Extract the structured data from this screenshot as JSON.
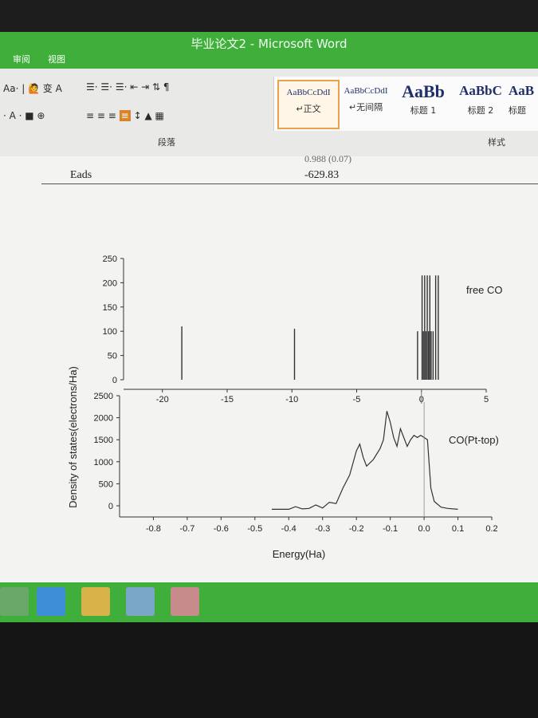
{
  "window": {
    "title": "毕业论文2 - Microsoft Word"
  },
  "menu": {
    "items": [
      "审阅",
      "视图"
    ]
  },
  "ribbon": {
    "font_row1": "Aa· | 🙋 变 A",
    "font_row2": "· A · ■ ⊕",
    "paragraph_label": "段落",
    "styles_label": "样式",
    "styles": [
      {
        "sample": "AaBbCcDdI",
        "name": "↵正文",
        "active": true
      },
      {
        "sample": "AaBbCcDdI",
        "name": "↵无间隔",
        "active": false
      },
      {
        "sample": "AaBb",
        "name": "标题 1",
        "active": false
      },
      {
        "sample": "AaBbC",
        "name": "标题 2",
        "active": false
      },
      {
        "sample": "AaB",
        "name": "标题",
        "active": false
      }
    ]
  },
  "document": {
    "cut_row_value": "0.988 (0.07)",
    "eads_label": "Eads",
    "eads_value": "-629.83"
  },
  "chart_data": [
    {
      "type": "bar",
      "title": "free CO",
      "xlim": [
        -23,
        5
      ],
      "ylim": [
        0,
        250
      ],
      "xticks": [
        -20,
        -15,
        -10,
        -5,
        0,
        5
      ],
      "yticks": [
        0,
        50,
        100,
        150,
        200,
        250
      ],
      "x": [
        -18.5,
        -9.8,
        -0.3,
        0.05,
        0.15,
        0.25,
        0.35,
        0.45,
        0.55,
        0.65,
        0.75,
        0.9,
        1.1,
        1.3
      ],
      "values": [
        110,
        105,
        100,
        215,
        100,
        215,
        100,
        215,
        100,
        215,
        100,
        100,
        215,
        215
      ],
      "grid": false
    },
    {
      "type": "line",
      "title": "CO(Pt-top)",
      "xlim": [
        -0.9,
        0.2
      ],
      "ylim": [
        0,
        2500
      ],
      "xticks": [
        -0.8,
        -0.7,
        -0.6,
        -0.5,
        -0.4,
        -0.3,
        -0.2,
        -0.1,
        0.0,
        0.1,
        0.2
      ],
      "xtick_labels": [
        "-0.8",
        "-0.7",
        "-0.6",
        "-0.5",
        "-0.4",
        "-0.3",
        "-0.2",
        "-0.1",
        "0.0",
        "0.1",
        "0.2"
      ],
      "yticks": [
        0,
        500,
        1000,
        1500,
        2000,
        2500
      ],
      "xlabel": "Energy(Ha)",
      "x": [
        -0.45,
        -0.4,
        -0.38,
        -0.36,
        -0.34,
        -0.32,
        -0.3,
        -0.28,
        -0.26,
        -0.24,
        -0.22,
        -0.2,
        -0.19,
        -0.18,
        -0.17,
        -0.15,
        -0.13,
        -0.12,
        -0.11,
        -0.1,
        -0.09,
        -0.08,
        -0.07,
        -0.06,
        -0.05,
        -0.04,
        -0.03,
        -0.02,
        -0.01,
        0.0,
        0.01,
        0.02,
        0.03,
        0.05,
        0.07,
        0.1
      ],
      "values": [
        -80,
        -80,
        -20,
        -70,
        -60,
        20,
        -50,
        80,
        50,
        400,
        700,
        1250,
        1400,
        1100,
        900,
        1050,
        1300,
        1500,
        2150,
        1900,
        1550,
        1350,
        1750,
        1550,
        1350,
        1500,
        1600,
        1550,
        1600,
        1550,
        1500,
        400,
        100,
        -30,
        -60,
        -80
      ],
      "grid": false
    }
  ],
  "shared_axis": {
    "ylabel": "Density of states(electrons/Ha)"
  },
  "colors": {
    "titlebar": "#3fae3b",
    "ribbon": "#e9e9e7",
    "page": "#f3f3f1",
    "line": "#333333"
  }
}
